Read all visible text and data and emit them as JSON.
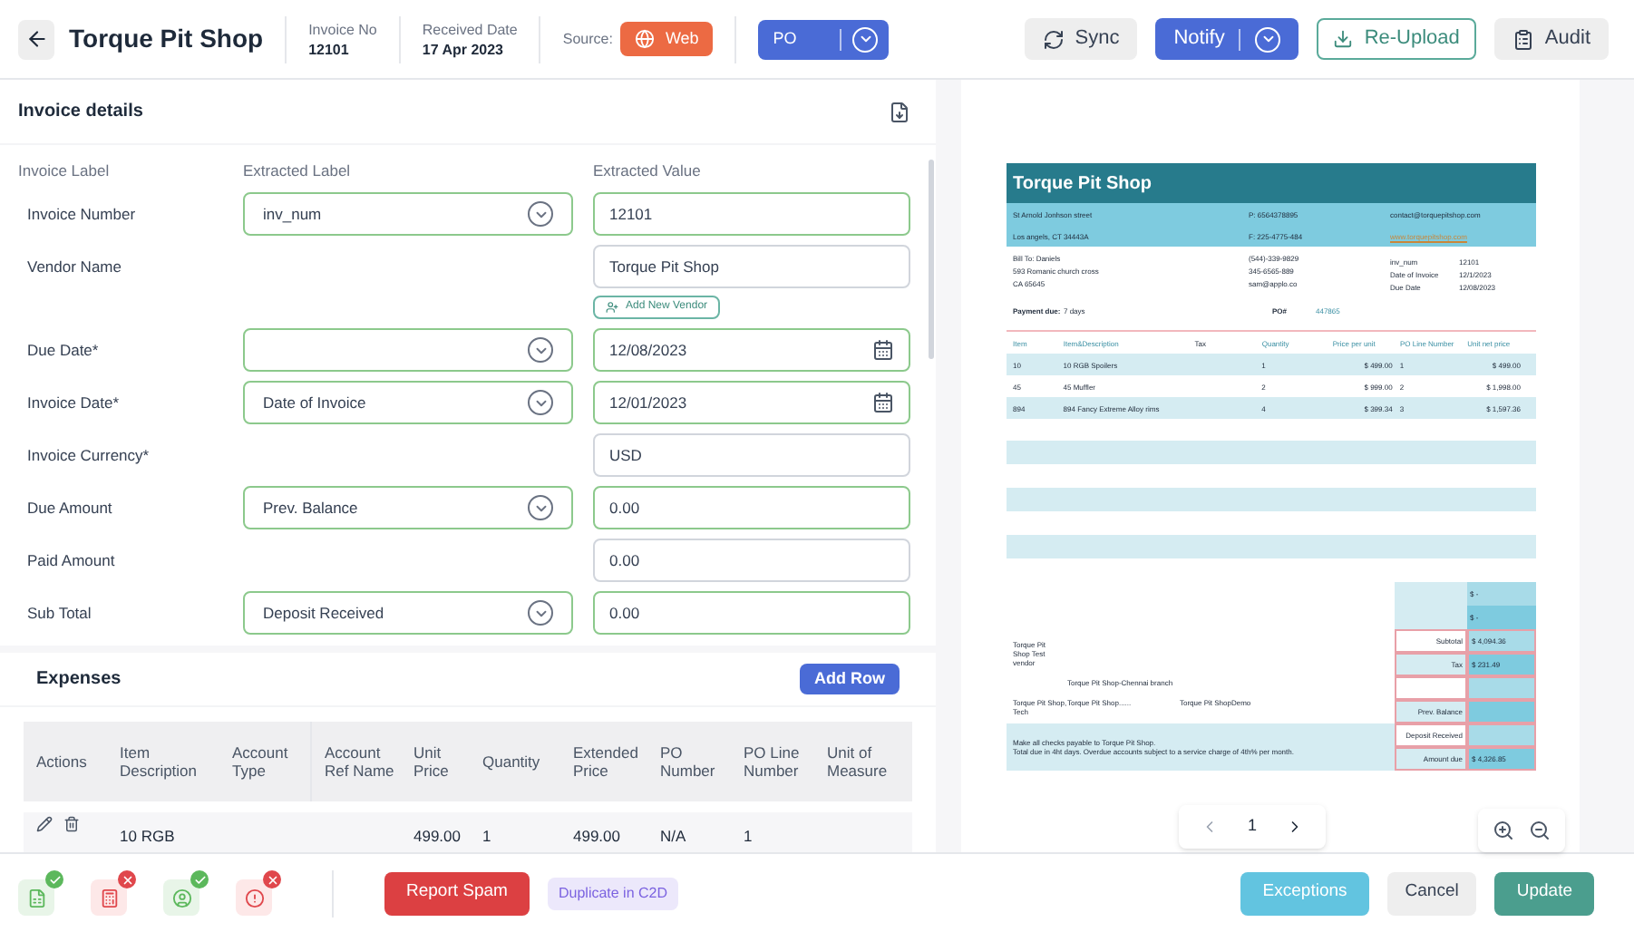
{
  "header": {
    "title": "Torque Pit Shop",
    "invoice_no": {
      "label": "Invoice No",
      "value": "12101"
    },
    "received_date": {
      "label": "Received Date",
      "value": "17 Apr 2023"
    },
    "source": {
      "label": "Source:",
      "value": "Web"
    },
    "type_select": "PO",
    "actions": [
      {
        "label": "Sync",
        "kind": "sync"
      },
      {
        "label": "Notify",
        "kind": "notify"
      },
      {
        "label": "Re-Upload",
        "kind": "upload"
      },
      {
        "label": "Audit",
        "kind": "audit"
      }
    ]
  },
  "details": {
    "title": "Invoice details",
    "columns": [
      "Invoice Label",
      "Extracted Label",
      "Extracted Value"
    ],
    "rows": [
      {
        "label": "Invoice Number",
        "select": true,
        "extracted_label": "inv_num",
        "value": "12101",
        "kind": "text",
        "matched": true
      },
      {
        "label": "Vendor Name",
        "select": false,
        "value": "Torque Pit Shop",
        "kind": "text",
        "matched": false,
        "add_button": "Add New Vendor"
      },
      {
        "label": "Due Date*",
        "select": true,
        "value": "12/08/2023",
        "kind": "date",
        "matched": true
      },
      {
        "label": "Invoice Date*",
        "select": true,
        "extracted_label": "Date of Invoice",
        "value": "12/01/2023",
        "kind": "date",
        "matched": true
      },
      {
        "label": "Invoice Currency*",
        "select": false,
        "value": "USD",
        "kind": "text",
        "matched": false
      },
      {
        "label": "Due Amount",
        "select": true,
        "extracted_label": "Prev. Balance",
        "value": "0.00",
        "kind": "text",
        "matched": true
      },
      {
        "label": "Paid Amount",
        "select": false,
        "value": "0.00",
        "kind": "text",
        "matched": false
      },
      {
        "label": "Sub Total",
        "select": true,
        "extracted_label": "Deposit Received",
        "value": "0.00",
        "kind": "text",
        "matched": true
      }
    ]
  },
  "expenses": {
    "title": "Expenses",
    "add_button": "Add Row",
    "columns": [
      "Actions",
      "Item Description",
      "Account Type",
      "Account Ref Name",
      "Unit Price",
      "Quantity",
      "Extended Price",
      "PO Number",
      "PO Line Number",
      "Unit of Measure"
    ],
    "rows": [
      {
        "cells": [
          null,
          "10 RGB",
          null,
          null,
          "499.00",
          "1",
          "499.00",
          "N/A",
          "1",
          null
        ]
      }
    ]
  },
  "preview": {
    "document": {
      "title": "Torque Pit Shop",
      "info": [
        [
          "St Arnold Jonhson street",
          "P: 6564378895",
          "contact@torquepitshop.com"
        ],
        [
          "Los angels, CT 34443A",
          "F: 225-4775-484",
          "www.torquepitshop.com"
        ]
      ],
      "bill_to": [
        "Bill To: Daniels",
        "593 Romanic church cross",
        "CA 65645"
      ],
      "contact": [
        "(544)-339-9829",
        "345-6565-889",
        "sam@applo.co"
      ],
      "meta": [
        [
          "inv_num",
          "12101"
        ],
        [
          "Date of Invoice",
          "12/1/2023"
        ],
        [
          "Due Date",
          "12/08/2023"
        ]
      ],
      "payment": [
        "Payment due:",
        "7 days",
        "PO#",
        "447865"
      ],
      "columns": [
        "Item",
        "Item&Description",
        "Tax",
        "Quantity",
        "Price per unit",
        "PO Line Number",
        "Unit net price"
      ],
      "rows": [
        [
          "10",
          "10 RGB Spoilers",
          "",
          "1",
          "$ 499.00",
          "1",
          "$ 499.00"
        ],
        [
          "45",
          "45 Muffler",
          "",
          "2",
          "$ 999.00",
          "2",
          "$ 1,998.00"
        ],
        [
          "894",
          "894 Fancy Extreme Alloy rims",
          "",
          "4",
          "$ 399.34",
          "3",
          "$ 1,597.36"
        ]
      ],
      "totals": [
        {
          "kind": "amount",
          "value": "$ -"
        },
        {
          "kind": "amount",
          "value": "$ -"
        },
        {
          "kind": "amount",
          "label": "Subtotal",
          "value": "$ 4,094.36"
        },
        {
          "kind": "amount",
          "label": "Tax",
          "value": "$ 231.49"
        },
        {
          "kind": "blank"
        },
        {
          "kind": "amount",
          "label": "Prev. Balance"
        },
        {
          "kind": "amount",
          "label": "Deposit Received"
        },
        {
          "kind": "amount",
          "label": "Amount due",
          "value": "$ 4,326.85"
        }
      ],
      "notes": [
        "Torque Pit Shop Test vendor",
        "Torque Pit Shop-Chennai branch",
        "Torque Pit Shop, Tech",
        "Torque Pit Shop......",
        "Torque Pit ShopDemo"
      ],
      "footer": [
        "Make all checks payable to Torque Pit Shop.",
        "Total due in 4ht days. Overdue accounts subject to a service charge of 4th% per month."
      ]
    },
    "page": "1"
  },
  "footer": {
    "checks": [
      {
        "kind": "document",
        "passed": true
      },
      {
        "kind": "calculator",
        "passed": false
      },
      {
        "kind": "person",
        "passed": true
      },
      {
        "kind": "alert",
        "passed": false
      }
    ],
    "report_spam": "Report Spam",
    "duplicate": "Duplicate in C2D",
    "exceptions": "Exceptions",
    "cancel": "Cancel",
    "update": "Update"
  }
}
